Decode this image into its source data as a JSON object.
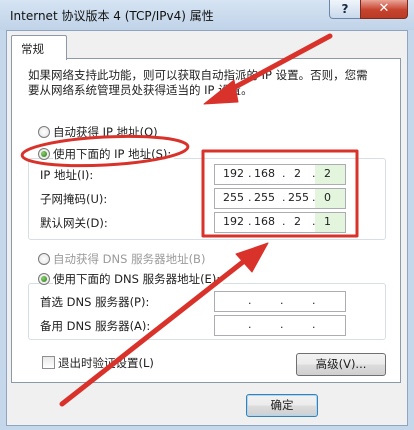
{
  "window": {
    "title": "Internet 协议版本 4 (TCP/IPv4) 属性",
    "help_label": "?",
    "close_label": "✕"
  },
  "tab": {
    "label": "常规"
  },
  "description": "如果网络支持此功能，则可以获取自动指派的 IP 设置。否则，您需要从网络系统管理员处获得适当的 IP 设置。",
  "ip_mode": {
    "auto_label": "自动获得 IP 地址(O)",
    "manual_label": "使用下面的 IP 地址(S):",
    "selected": "manual"
  },
  "ip_fields": [
    {
      "label": "IP 地址(I):",
      "octets": [
        "192",
        "168",
        "2",
        "2"
      ]
    },
    {
      "label": "子网掩码(U):",
      "octets": [
        "255",
        "255",
        "255",
        "0"
      ]
    },
    {
      "label": "默认网关(D):",
      "octets": [
        "192",
        "168",
        "2",
        "1"
      ]
    }
  ],
  "dns_mode": {
    "auto_label": "自动获得 DNS 服务器地址(B)",
    "manual_label": "使用下面的 DNS 服务器地址(E):",
    "selected": "manual"
  },
  "dns_fields": [
    {
      "label": "首选 DNS 服务器(P):",
      "octets": [
        "",
        "",
        "",
        ""
      ]
    },
    {
      "label": "备用 DNS 服务器(A):",
      "octets": [
        "",
        "",
        "",
        ""
      ]
    }
  ],
  "validate_label": "退出时验证设置(L)",
  "advanced_label": "高级(V)...",
  "ok_label": "确定",
  "annotation_color": "#d9322b"
}
